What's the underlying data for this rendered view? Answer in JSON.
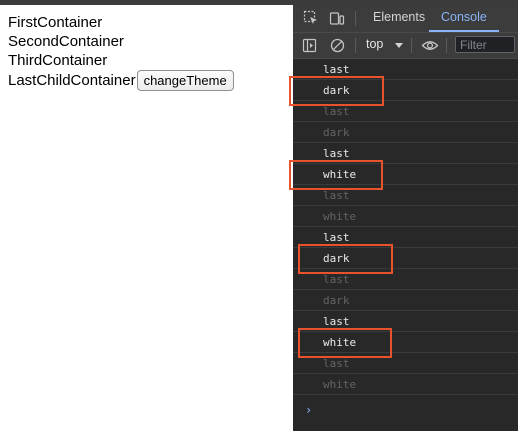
{
  "page": {
    "lines": [
      "FirstContainer",
      "SecondContainer",
      "ThirdContainer"
    ],
    "last_container_text": "LastChildContainer",
    "button_label": "changeTheme"
  },
  "devtools": {
    "tabs": {
      "elements": "Elements",
      "console": "Console"
    },
    "context": "top",
    "filter_placeholder": "Filter",
    "console_messages": [
      {
        "text": "last",
        "faded": false
      },
      {
        "text": "dark",
        "faded": false
      },
      {
        "text": "last",
        "faded": true
      },
      {
        "text": "dark",
        "faded": true
      },
      {
        "text": "last",
        "faded": false
      },
      {
        "text": "white",
        "faded": false
      },
      {
        "text": "last",
        "faded": true
      },
      {
        "text": "white",
        "faded": true
      },
      {
        "text": "last",
        "faded": false
      },
      {
        "text": "dark",
        "faded": false
      },
      {
        "text": "last",
        "faded": true
      },
      {
        "text": "dark",
        "faded": true
      },
      {
        "text": "last",
        "faded": false
      },
      {
        "text": "white",
        "faded": false
      },
      {
        "text": "last",
        "faded": true
      },
      {
        "text": "white",
        "faded": true
      }
    ],
    "prompt_symbol": "›",
    "highlighted_rows": [
      1,
      5,
      9,
      13
    ],
    "highlight_color": "#e8532b"
  }
}
